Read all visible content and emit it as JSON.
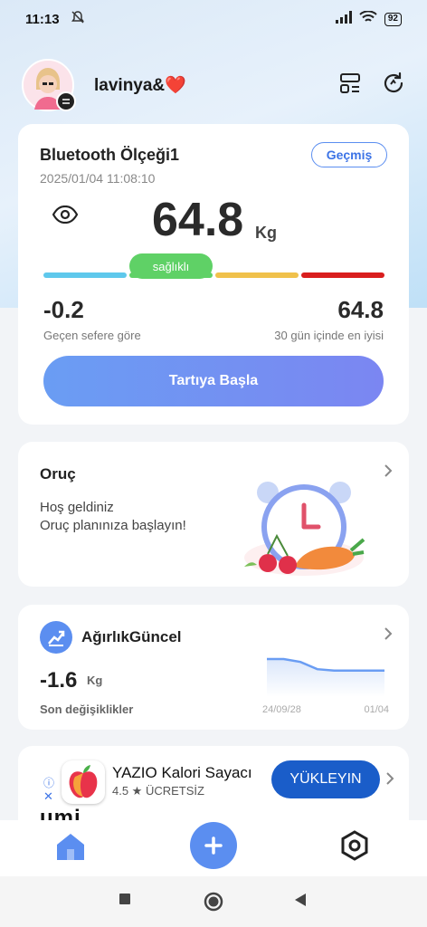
{
  "status_bar": {
    "time": "11:13",
    "battery": "92"
  },
  "header": {
    "username": "lavinya&❤️"
  },
  "scale_card": {
    "name": "Bluetooth Ölçeği1",
    "datetime": "2025/01/04 11:08:10",
    "history_label": "Geçmiş",
    "weight": "64.8",
    "unit": "Kg",
    "status": "sağlıklı",
    "segment_colors": [
      "#5fc8ec",
      "#5fd166",
      "#f0c14b",
      "#d91e1e"
    ],
    "change_value": "-0.2",
    "change_label": "Geçen sefere göre",
    "best_value": "64.8",
    "best_label": "30 gün içinde en iyisi",
    "start_button": "Tartıya Başla"
  },
  "fasting_card": {
    "title": "Oruç",
    "line1": "Hoş geldiniz",
    "line2": "Oruç planınıza başlayın!"
  },
  "trend_card": {
    "title": "AğırlıkGüncel",
    "delta": "-1.6",
    "delta_unit": "Kg",
    "label": "Son değişiklikler",
    "date_start": "24/09/28",
    "date_end": "01/04",
    "series": [
      1.0,
      1.0,
      0.92,
      0.72,
      0.68,
      0.68,
      0.68,
      0.68
    ]
  },
  "ad_card": {
    "app_name": "YAZIO Kalori Sayacı",
    "rating": "4.5 ★ ÜCRETSİZ",
    "install_label": "YÜKLEYIN",
    "brand_peek": "umi"
  },
  "colors": {
    "accent": "#5b8ef0",
    "healthy": "#5fd166"
  }
}
